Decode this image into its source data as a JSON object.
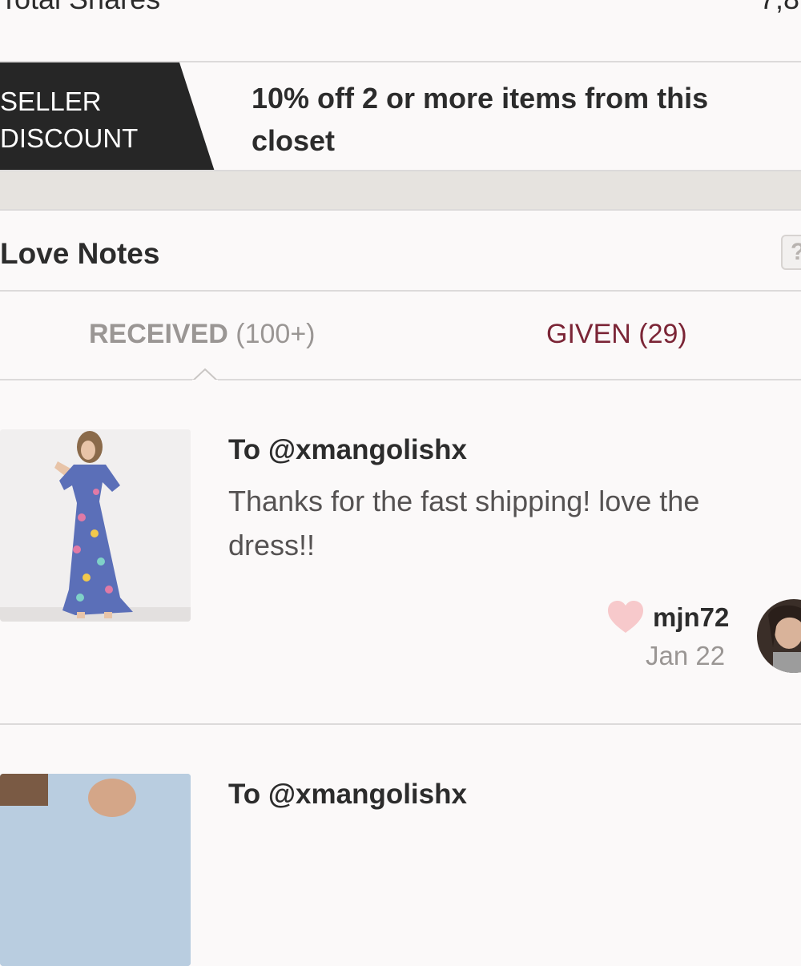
{
  "stats": {
    "label": "Total Shares",
    "value": "7,8"
  },
  "seller_discount": {
    "badge_line1": "SELLER",
    "badge_line2": "DISCOUNT",
    "text": "10% off 2 or more items from this closet"
  },
  "love_notes": {
    "title": "Love Notes",
    "help_label": "?",
    "tabs": [
      {
        "label": "RECEIVED",
        "count": "(100+)",
        "selected": true
      },
      {
        "label": "GIVEN",
        "count": "(29)",
        "selected": false
      }
    ],
    "notes": [
      {
        "to": "To @xmangolishx",
        "message": "Thanks for the fast shipping! love the dress!!",
        "from_user": "mjn72",
        "date": "Jan 22",
        "icon": "heart-icon"
      },
      {
        "to": "To @xmangolishx"
      }
    ]
  },
  "colors": {
    "badge_bg": "#262626",
    "given_tab": "#7b2536",
    "heart": "#f7c9cb",
    "gap_bg": "#e6e3df"
  }
}
